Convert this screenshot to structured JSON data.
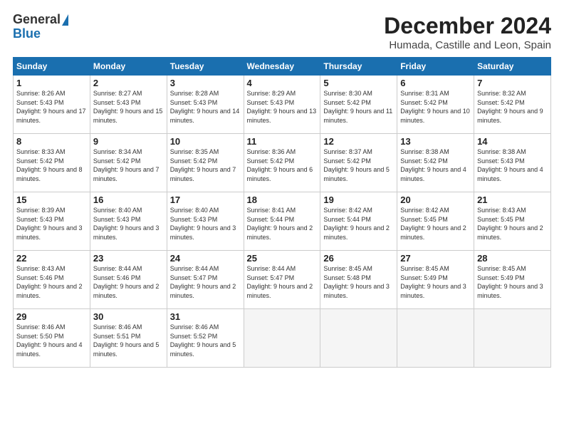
{
  "header": {
    "logo_general": "General",
    "logo_blue": "Blue",
    "title": "December 2024",
    "subtitle": "Humada, Castille and Leon, Spain"
  },
  "weekdays": [
    "Sunday",
    "Monday",
    "Tuesday",
    "Wednesday",
    "Thursday",
    "Friday",
    "Saturday"
  ],
  "weeks": [
    [
      {
        "day": "1",
        "sunrise": "Sunrise: 8:26 AM",
        "sunset": "Sunset: 5:43 PM",
        "daylight": "Daylight: 9 hours and 17 minutes."
      },
      {
        "day": "2",
        "sunrise": "Sunrise: 8:27 AM",
        "sunset": "Sunset: 5:43 PM",
        "daylight": "Daylight: 9 hours and 15 minutes."
      },
      {
        "day": "3",
        "sunrise": "Sunrise: 8:28 AM",
        "sunset": "Sunset: 5:43 PM",
        "daylight": "Daylight: 9 hours and 14 minutes."
      },
      {
        "day": "4",
        "sunrise": "Sunrise: 8:29 AM",
        "sunset": "Sunset: 5:43 PM",
        "daylight": "Daylight: 9 hours and 13 minutes."
      },
      {
        "day": "5",
        "sunrise": "Sunrise: 8:30 AM",
        "sunset": "Sunset: 5:42 PM",
        "daylight": "Daylight: 9 hours and 11 minutes."
      },
      {
        "day": "6",
        "sunrise": "Sunrise: 8:31 AM",
        "sunset": "Sunset: 5:42 PM",
        "daylight": "Daylight: 9 hours and 10 minutes."
      },
      {
        "day": "7",
        "sunrise": "Sunrise: 8:32 AM",
        "sunset": "Sunset: 5:42 PM",
        "daylight": "Daylight: 9 hours and 9 minutes."
      }
    ],
    [
      {
        "day": "8",
        "sunrise": "Sunrise: 8:33 AM",
        "sunset": "Sunset: 5:42 PM",
        "daylight": "Daylight: 9 hours and 8 minutes."
      },
      {
        "day": "9",
        "sunrise": "Sunrise: 8:34 AM",
        "sunset": "Sunset: 5:42 PM",
        "daylight": "Daylight: 9 hours and 7 minutes."
      },
      {
        "day": "10",
        "sunrise": "Sunrise: 8:35 AM",
        "sunset": "Sunset: 5:42 PM",
        "daylight": "Daylight: 9 hours and 7 minutes."
      },
      {
        "day": "11",
        "sunrise": "Sunrise: 8:36 AM",
        "sunset": "Sunset: 5:42 PM",
        "daylight": "Daylight: 9 hours and 6 minutes."
      },
      {
        "day": "12",
        "sunrise": "Sunrise: 8:37 AM",
        "sunset": "Sunset: 5:42 PM",
        "daylight": "Daylight: 9 hours and 5 minutes."
      },
      {
        "day": "13",
        "sunrise": "Sunrise: 8:38 AM",
        "sunset": "Sunset: 5:42 PM",
        "daylight": "Daylight: 9 hours and 4 minutes."
      },
      {
        "day": "14",
        "sunrise": "Sunrise: 8:38 AM",
        "sunset": "Sunset: 5:43 PM",
        "daylight": "Daylight: 9 hours and 4 minutes."
      }
    ],
    [
      {
        "day": "15",
        "sunrise": "Sunrise: 8:39 AM",
        "sunset": "Sunset: 5:43 PM",
        "daylight": "Daylight: 9 hours and 3 minutes."
      },
      {
        "day": "16",
        "sunrise": "Sunrise: 8:40 AM",
        "sunset": "Sunset: 5:43 PM",
        "daylight": "Daylight: 9 hours and 3 minutes."
      },
      {
        "day": "17",
        "sunrise": "Sunrise: 8:40 AM",
        "sunset": "Sunset: 5:43 PM",
        "daylight": "Daylight: 9 hours and 3 minutes."
      },
      {
        "day": "18",
        "sunrise": "Sunrise: 8:41 AM",
        "sunset": "Sunset: 5:44 PM",
        "daylight": "Daylight: 9 hours and 2 minutes."
      },
      {
        "day": "19",
        "sunrise": "Sunrise: 8:42 AM",
        "sunset": "Sunset: 5:44 PM",
        "daylight": "Daylight: 9 hours and 2 minutes."
      },
      {
        "day": "20",
        "sunrise": "Sunrise: 8:42 AM",
        "sunset": "Sunset: 5:45 PM",
        "daylight": "Daylight: 9 hours and 2 minutes."
      },
      {
        "day": "21",
        "sunrise": "Sunrise: 8:43 AM",
        "sunset": "Sunset: 5:45 PM",
        "daylight": "Daylight: 9 hours and 2 minutes."
      }
    ],
    [
      {
        "day": "22",
        "sunrise": "Sunrise: 8:43 AM",
        "sunset": "Sunset: 5:46 PM",
        "daylight": "Daylight: 9 hours and 2 minutes."
      },
      {
        "day": "23",
        "sunrise": "Sunrise: 8:44 AM",
        "sunset": "Sunset: 5:46 PM",
        "daylight": "Daylight: 9 hours and 2 minutes."
      },
      {
        "day": "24",
        "sunrise": "Sunrise: 8:44 AM",
        "sunset": "Sunset: 5:47 PM",
        "daylight": "Daylight: 9 hours and 2 minutes."
      },
      {
        "day": "25",
        "sunrise": "Sunrise: 8:44 AM",
        "sunset": "Sunset: 5:47 PM",
        "daylight": "Daylight: 9 hours and 2 minutes."
      },
      {
        "day": "26",
        "sunrise": "Sunrise: 8:45 AM",
        "sunset": "Sunset: 5:48 PM",
        "daylight": "Daylight: 9 hours and 3 minutes."
      },
      {
        "day": "27",
        "sunrise": "Sunrise: 8:45 AM",
        "sunset": "Sunset: 5:49 PM",
        "daylight": "Daylight: 9 hours and 3 minutes."
      },
      {
        "day": "28",
        "sunrise": "Sunrise: 8:45 AM",
        "sunset": "Sunset: 5:49 PM",
        "daylight": "Daylight: 9 hours and 3 minutes."
      }
    ],
    [
      {
        "day": "29",
        "sunrise": "Sunrise: 8:46 AM",
        "sunset": "Sunset: 5:50 PM",
        "daylight": "Daylight: 9 hours and 4 minutes."
      },
      {
        "day": "30",
        "sunrise": "Sunrise: 8:46 AM",
        "sunset": "Sunset: 5:51 PM",
        "daylight": "Daylight: 9 hours and 5 minutes."
      },
      {
        "day": "31",
        "sunrise": "Sunrise: 8:46 AM",
        "sunset": "Sunset: 5:52 PM",
        "daylight": "Daylight: 9 hours and 5 minutes."
      },
      null,
      null,
      null,
      null
    ]
  ]
}
